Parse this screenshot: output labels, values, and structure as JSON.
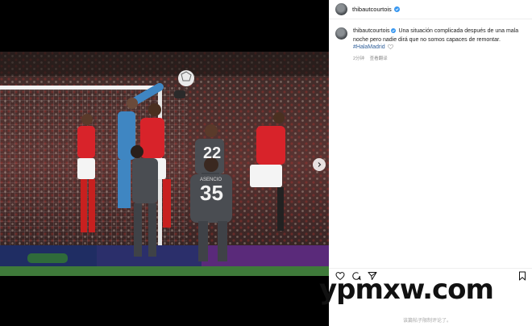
{
  "post": {
    "username": "thibautcourtois",
    "caption_username": "thibautcourtois",
    "caption_text": "Una situación complicada después de una mala noche pero nadie dirá que no somos capaces de remontar.",
    "hashtag": "#HalaMadrid",
    "time_ago": "2分钟",
    "translate_label": "查看翻译",
    "comments_disabled": "该篇帖子限制评论了。"
  },
  "photo": {
    "shirt_numbers": [
      "22",
      "35"
    ],
    "name_on_shirt": "ASENCIO"
  },
  "icons": [
    "verified-icon",
    "heart-icon",
    "comment-icon",
    "share-icon",
    "bookmark-icon",
    "chevron-right-icon"
  ],
  "watermark": "ypmxw.com",
  "colors": {
    "verified": "#3897f0",
    "hashtag": "#2f5f9a",
    "arsenal_red": "#d8232a",
    "madrid_kit": "#4a4d52"
  }
}
